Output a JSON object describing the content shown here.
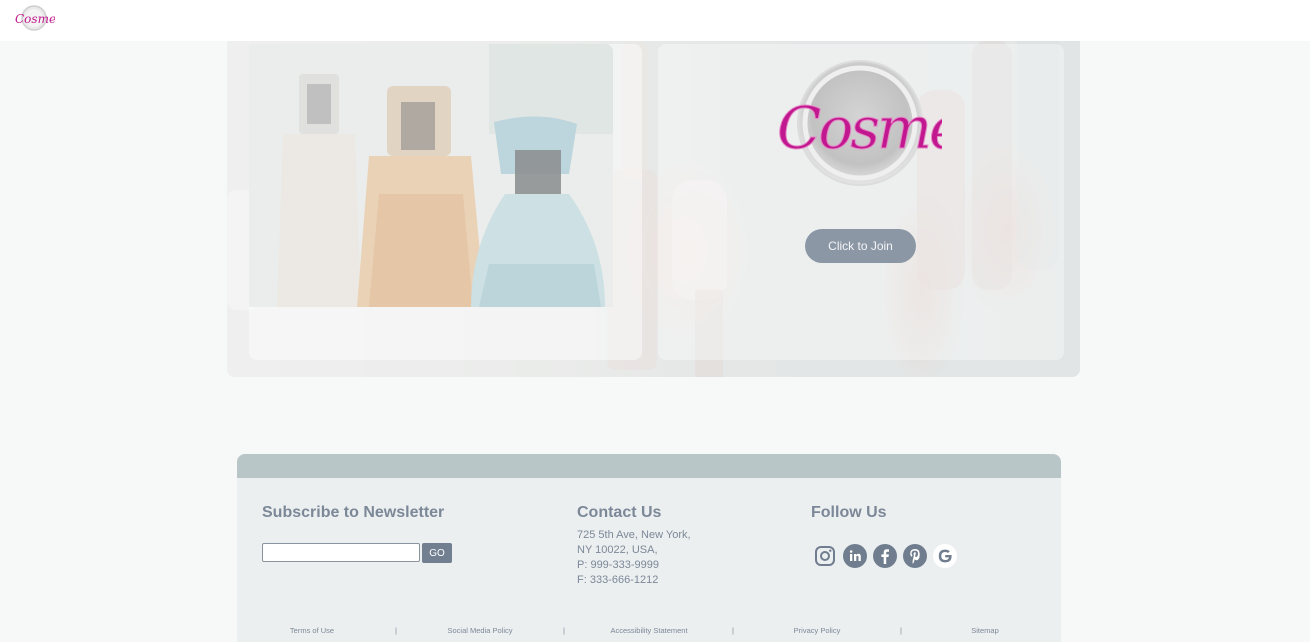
{
  "header": {
    "logo_text": "Cosmet",
    "logo_icon": "cosmet-logo-icon"
  },
  "hero": {
    "brand_logo_text": "Cosmet",
    "join_button_label": "Click to Join",
    "image_icon": "perfume-bottles-photo"
  },
  "footer": {
    "newsletter": {
      "title": "Subscribe to Newsletter",
      "input_value": "",
      "input_placeholder": "",
      "go_label": "GO"
    },
    "contact": {
      "title": "Contact Us",
      "lines": [
        "725 5th Ave, New York,",
        "NY 10022, USA,",
        "P: 999-333-9999",
        "F: 333-666-1212"
      ]
    },
    "follow": {
      "title": "Follow Us",
      "icons": [
        "instagram-icon",
        "linkedin-icon",
        "facebook-icon",
        "pinterest-icon",
        "google-icon"
      ]
    },
    "legal": {
      "links": [
        "Terms of Use",
        "Social Media Policy",
        "Accessibility Statement",
        "Privacy Policy",
        "Sitemap"
      ],
      "separator": "|"
    }
  },
  "colors": {
    "page_bg": "#f7f8f8",
    "footer_bg": "#eceff0",
    "footer_band": "#b9c6c7",
    "text_muted": "#7c8898",
    "button_bg": "#8c97a6",
    "brand_pink": "#c2188f"
  }
}
